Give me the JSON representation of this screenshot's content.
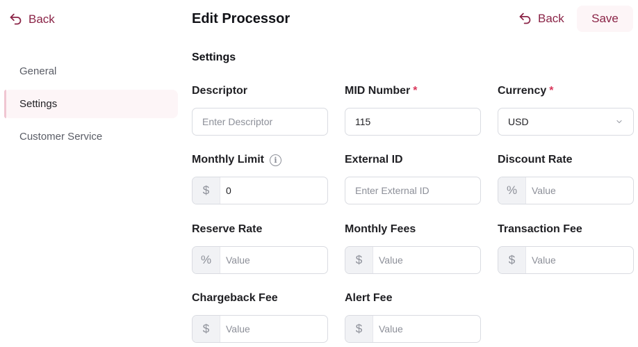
{
  "sidebar": {
    "back_label": "Back",
    "items": [
      {
        "label": "General"
      },
      {
        "label": "Settings"
      },
      {
        "label": "Customer Service"
      }
    ]
  },
  "header": {
    "title": "Edit Processor",
    "back_label": "Back",
    "save_label": "Save"
  },
  "section": {
    "title": "Settings"
  },
  "fields": {
    "descriptor": {
      "label": "Descriptor",
      "value": "",
      "placeholder": "Enter Descriptor"
    },
    "mid_number": {
      "label": "MID Number",
      "required": "*",
      "value": "115",
      "placeholder": ""
    },
    "currency": {
      "label": "Currency",
      "required": "*",
      "value": "USD"
    },
    "monthly_limit": {
      "label": "Monthly Limit",
      "prefix": "$",
      "value": "0",
      "placeholder": ""
    },
    "external_id": {
      "label": "External ID",
      "value": "",
      "placeholder": "Enter External ID"
    },
    "discount_rate": {
      "label": "Discount Rate",
      "prefix": "%",
      "value": "",
      "placeholder": "Value"
    },
    "reserve_rate": {
      "label": "Reserve Rate",
      "prefix": "%",
      "value": "",
      "placeholder": "Value"
    },
    "monthly_fees": {
      "label": "Monthly Fees",
      "prefix": "$",
      "value": "",
      "placeholder": "Value"
    },
    "transaction_fee": {
      "label": "Transaction Fee",
      "prefix": "$",
      "value": "",
      "placeholder": "Value"
    },
    "chargeback_fee": {
      "label": "Chargeback Fee",
      "prefix": "$",
      "value": "",
      "placeholder": "Value"
    },
    "alert_fee": {
      "label": "Alert Fee",
      "prefix": "$",
      "value": "",
      "placeholder": "Value"
    }
  },
  "colors": {
    "accent": "#8a2346",
    "required": "#d9365a",
    "active_nav_bg": "#fdf5f7"
  },
  "icons": {
    "back": "undo-arrow-icon",
    "info": "info-circle-icon",
    "dropdown": "chevron-down-icon",
    "dollar": "dollar-icon",
    "percent": "percent-icon"
  }
}
